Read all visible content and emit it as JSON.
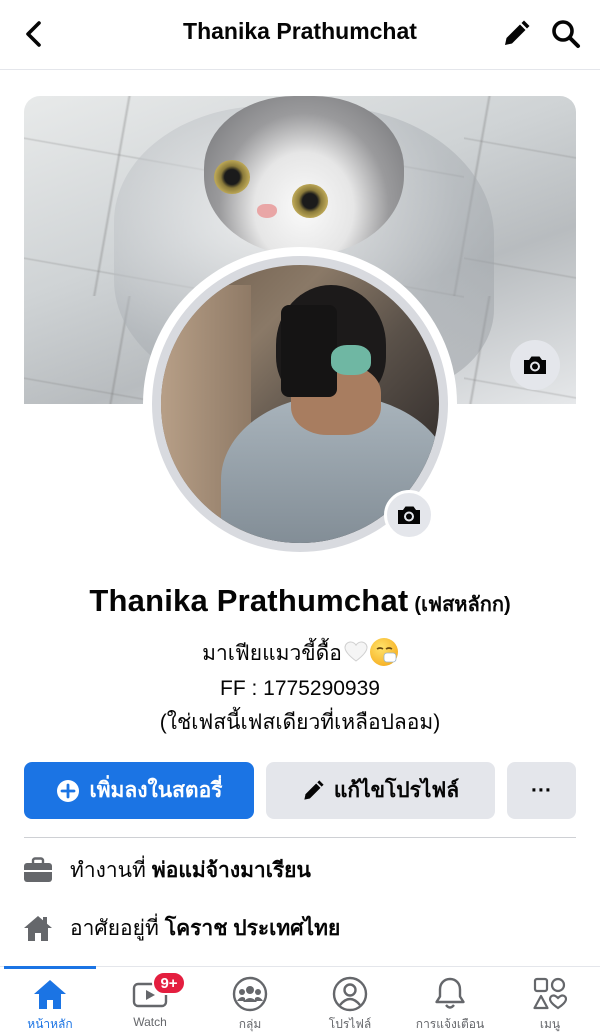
{
  "header": {
    "title": "Thanika Prathumchat",
    "back_icon": "chevron-left-icon",
    "edit_icon": "pencil-icon",
    "search_icon": "search-icon"
  },
  "profile": {
    "name": "Thanika Prathumchat",
    "alternate_name": "(เฟสหลักก)",
    "bio_line1": "มาเฟียแมวขี้ดื้อ",
    "bio_line2": "FF : 1775290939",
    "bio_line3": "(ใช่เฟสนี้เฟสเดียวที่เหลือปลอม)"
  },
  "actions": {
    "add_story": "เพิ่มลงในสตอรี่",
    "edit_profile": "แก้ไขโปรไฟล์",
    "more": "···"
  },
  "intro": {
    "work_prefix": "ทำงานที่",
    "work_value": "พ่อแม่จ้างมาเรียน",
    "home_prefix": "อาศัยอยู่ที่",
    "home_value": "โคราช ประเทศไทย"
  },
  "tabbar": {
    "tabs": [
      {
        "label": "หน้าหลัก",
        "icon": "home-icon",
        "active": true
      },
      {
        "label": "Watch",
        "icon": "watch-video-icon",
        "badge": "9+"
      },
      {
        "label": "กลุ่ม",
        "icon": "groups-icon"
      },
      {
        "label": "โปรไฟล์",
        "icon": "profile-icon"
      },
      {
        "label": "การแจ้งเตือน",
        "icon": "bell-icon"
      },
      {
        "label": "เมนู",
        "icon": "menu-icon"
      }
    ]
  },
  "colors": {
    "accent": "#1b74e4",
    "button_gray": "#e4e6eb",
    "badge_red": "#e41e3f",
    "secondary_text": "#65676b"
  }
}
